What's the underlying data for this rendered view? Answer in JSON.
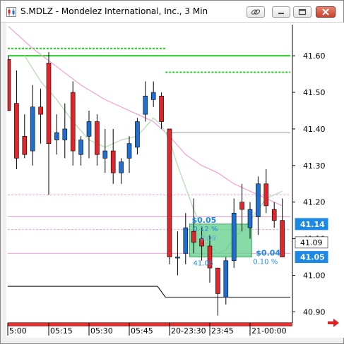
{
  "window": {
    "title": "S.MDLZ - Mondelez International, Inc., 3 Min"
  },
  "colors": {
    "up": "#1f6fd1",
    "down": "#e0262b",
    "green_line": "#22d022",
    "pink_line": "#f2a0d2",
    "sma_line": "#bfe0bf",
    "black_line": "#000000",
    "highlight_fill": "#5fcf8a",
    "axis_highlight": "#1e88e5",
    "nav_arrow": "#e02020"
  },
  "price_axis": {
    "ticks": [
      "41.60",
      "41.50",
      "41.40",
      "41.30",
      "41.20",
      "41.10",
      "41.00",
      "40.90"
    ],
    "highlights": [
      {
        "label": "41.14",
        "value": 41.14,
        "style": "blue"
      },
      {
        "label": "41.09",
        "value": 41.09,
        "style": "gray"
      },
      {
        "label": "41.05",
        "value": 41.05,
        "style": "blue"
      }
    ]
  },
  "time_axis": {
    "labels": [
      {
        "text": "5:00",
        "bar": -0.3
      },
      {
        "text": "05:15",
        "bar": 5
      },
      {
        "text": "05:30",
        "bar": 10
      },
      {
        "text": "05:45",
        "bar": 15
      },
      {
        "text": "20-23:30",
        "bar": 20
      },
      {
        "text": "23:45",
        "bar": 25
      },
      {
        "text": "21-00:00",
        "bar": 30
      }
    ]
  },
  "chart_data": {
    "type": "candlestick",
    "symbol": "S.MDLZ",
    "ylim": [
      40.87,
      41.685
    ],
    "bars": [
      {
        "o": 41.59,
        "h": 41.6,
        "l": 41.45,
        "c": 41.45
      },
      {
        "o": 41.47,
        "h": 41.56,
        "l": 41.29,
        "c": 41.32
      },
      {
        "o": 41.38,
        "h": 41.44,
        "l": 41.32,
        "c": 41.33
      },
      {
        "o": 41.34,
        "h": 41.52,
        "l": 41.3,
        "c": 41.46
      },
      {
        "o": 41.46,
        "h": 41.51,
        "l": 41.36,
        "c": 41.44
      },
      {
        "o": 41.58,
        "h": 41.61,
        "l": 41.22,
        "c": 41.36
      },
      {
        "o": 41.37,
        "h": 41.44,
        "l": 41.33,
        "c": 41.39
      },
      {
        "o": 41.37,
        "h": 41.47,
        "l": 41.32,
        "c": 41.4
      },
      {
        "o": 41.5,
        "h": 41.53,
        "l": 41.3,
        "c": 41.34
      },
      {
        "o": 41.33,
        "h": 41.38,
        "l": 41.3,
        "c": 41.37
      },
      {
        "o": 41.38,
        "h": 41.45,
        "l": 41.32,
        "c": 41.42
      },
      {
        "o": 41.42,
        "h": 41.44,
        "l": 41.3,
        "c": 41.33
      },
      {
        "o": 41.32,
        "h": 41.4,
        "l": 41.28,
        "c": 41.34
      },
      {
        "o": 41.34,
        "h": 41.4,
        "l": 41.25,
        "c": 41.28
      },
      {
        "o": 41.28,
        "h": 41.32,
        "l": 41.25,
        "c": 41.31
      },
      {
        "o": 41.32,
        "h": 41.38,
        "l": 41.28,
        "c": 41.36
      },
      {
        "o": 41.35,
        "h": 41.43,
        "l": 41.33,
        "c": 41.42
      },
      {
        "o": 41.44,
        "h": 41.53,
        "l": 41.42,
        "c": 41.49
      },
      {
        "o": 41.48,
        "h": 41.53,
        "l": 41.46,
        "c": 41.5
      },
      {
        "o": 41.49,
        "h": 41.5,
        "l": 41.4,
        "c": 41.42
      },
      {
        "o": 41.4,
        "h": 41.4,
        "l": 41.03,
        "c": 41.05
      },
      {
        "o": 41.05,
        "h": 41.12,
        "l": 41.0,
        "c": 41.05
      },
      {
        "o": 41.06,
        "h": 41.17,
        "l": 41.03,
        "c": 41.13
      },
      {
        "o": 41.12,
        "h": 41.21,
        "l": 41.06,
        "c": 41.09
      },
      {
        "o": 41.1,
        "h": 41.13,
        "l": 41.04,
        "c": 41.08
      },
      {
        "o": 41.08,
        "h": 41.11,
        "l": 40.98,
        "c": 41.02
      },
      {
        "o": 41.02,
        "h": 41.02,
        "l": 40.89,
        "c": 40.95
      },
      {
        "o": 40.94,
        "h": 41.05,
        "l": 40.92,
        "c": 41.04
      },
      {
        "o": 41.04,
        "h": 41.21,
        "l": 41.02,
        "c": 41.17
      },
      {
        "o": 41.2,
        "h": 41.25,
        "l": 41.12,
        "c": 41.18
      },
      {
        "o": 41.13,
        "h": 41.2,
        "l": 41.1,
        "c": 41.18
      },
      {
        "o": 41.16,
        "h": 41.27,
        "l": 41.11,
        "c": 41.25
      },
      {
        "o": 41.25,
        "h": 41.29,
        "l": 41.17,
        "c": 41.19
      },
      {
        "o": 41.18,
        "h": 41.2,
        "l": 41.13,
        "c": 41.15
      },
      {
        "o": 41.15,
        "h": 41.21,
        "l": 41.05,
        "c": 41.05
      }
    ],
    "level_lines": [
      {
        "name": "green-level-left",
        "color": "green",
        "style": "dashed",
        "y": 41.62,
        "from_bar": -1,
        "to_bar": 19.5
      },
      {
        "name": "green-level-mid",
        "color": "green",
        "style": "solid",
        "y": 41.6,
        "from_bar": -1,
        "to_bar": 19.5
      },
      {
        "name": "green-level-right-top",
        "color": "green",
        "style": "solid",
        "y": 41.6,
        "from_bar": 19.5,
        "to_bar": 35
      },
      {
        "name": "green-level-right-dash",
        "color": "green",
        "style": "dashed",
        "y": 41.555,
        "from_bar": 19.5,
        "to_bar": 35
      },
      {
        "name": "gray-level",
        "color": "gray",
        "style": "solid",
        "y": 41.39,
        "from_bar": 19.5,
        "to_bar": 35
      },
      {
        "name": "pink-level-a",
        "color": "pink",
        "style": "dashed",
        "y": 41.22,
        "from_bar": -1,
        "to_bar": 35
      },
      {
        "name": "pink-level-b",
        "color": "pink",
        "style": "solid",
        "y": 41.16,
        "from_bar": -1,
        "to_bar": 35
      },
      {
        "name": "pink-level-c",
        "color": "pink",
        "style": "dashed",
        "y": 41.125,
        "from_bar": -1,
        "to_bar": 35
      },
      {
        "name": "pink-level-d",
        "color": "pink",
        "style": "solid",
        "y": 41.06,
        "from_bar": -1,
        "to_bar": 35
      },
      {
        "name": "black-level-left",
        "color": "black",
        "style": "solid",
        "y": 40.97,
        "from_bar": -1,
        "to_bar": 18.5
      },
      {
        "name": "black-level-right",
        "color": "black",
        "style": "solid",
        "y": 40.94,
        "from_bar": 19.5,
        "to_bar": 35
      }
    ],
    "ma_pink": [
      [
        0,
        41.68
      ],
      [
        3,
        41.62
      ],
      [
        6,
        41.57
      ],
      [
        9,
        41.52
      ],
      [
        12,
        41.48
      ],
      [
        15,
        41.45
      ],
      [
        18,
        41.42
      ],
      [
        20,
        41.38
      ],
      [
        22,
        41.33
      ],
      [
        24,
        41.3
      ],
      [
        26,
        41.28
      ],
      [
        28,
        41.25
      ],
      [
        30,
        41.23
      ],
      [
        32,
        41.21
      ],
      [
        34,
        41.19
      ]
    ],
    "ma_green": [
      [
        2,
        41.6
      ],
      [
        4,
        41.53
      ],
      [
        6,
        41.48
      ],
      [
        8,
        41.42
      ],
      [
        10,
        41.37
      ],
      [
        12,
        41.35
      ],
      [
        14,
        41.37
      ],
      [
        16,
        41.38
      ],
      [
        18,
        41.43
      ],
      [
        19,
        41.41
      ],
      [
        20,
        41.37
      ],
      [
        21,
        41.3
      ],
      [
        22,
        41.24
      ],
      [
        23,
        41.18
      ],
      [
        24,
        41.13
      ],
      [
        25,
        41.08
      ],
      [
        26,
        41.06
      ],
      [
        27,
        41.07
      ],
      [
        28,
        41.1
      ],
      [
        30,
        41.15
      ],
      [
        32,
        41.21
      ],
      [
        34,
        41.23
      ]
    ],
    "trade_box": {
      "from_bar": 22.5,
      "to_bar": 30.2,
      "top": 41.14,
      "bottom": 41.05,
      "texts": {
        "top_amount": "$0.05",
        "top_percent": "0.12 %",
        "top_mid": "0.09",
        "bottom_amount": "$0.04",
        "bottom_percent": "0.10 %",
        "bottom_price": "41.05"
      }
    }
  }
}
